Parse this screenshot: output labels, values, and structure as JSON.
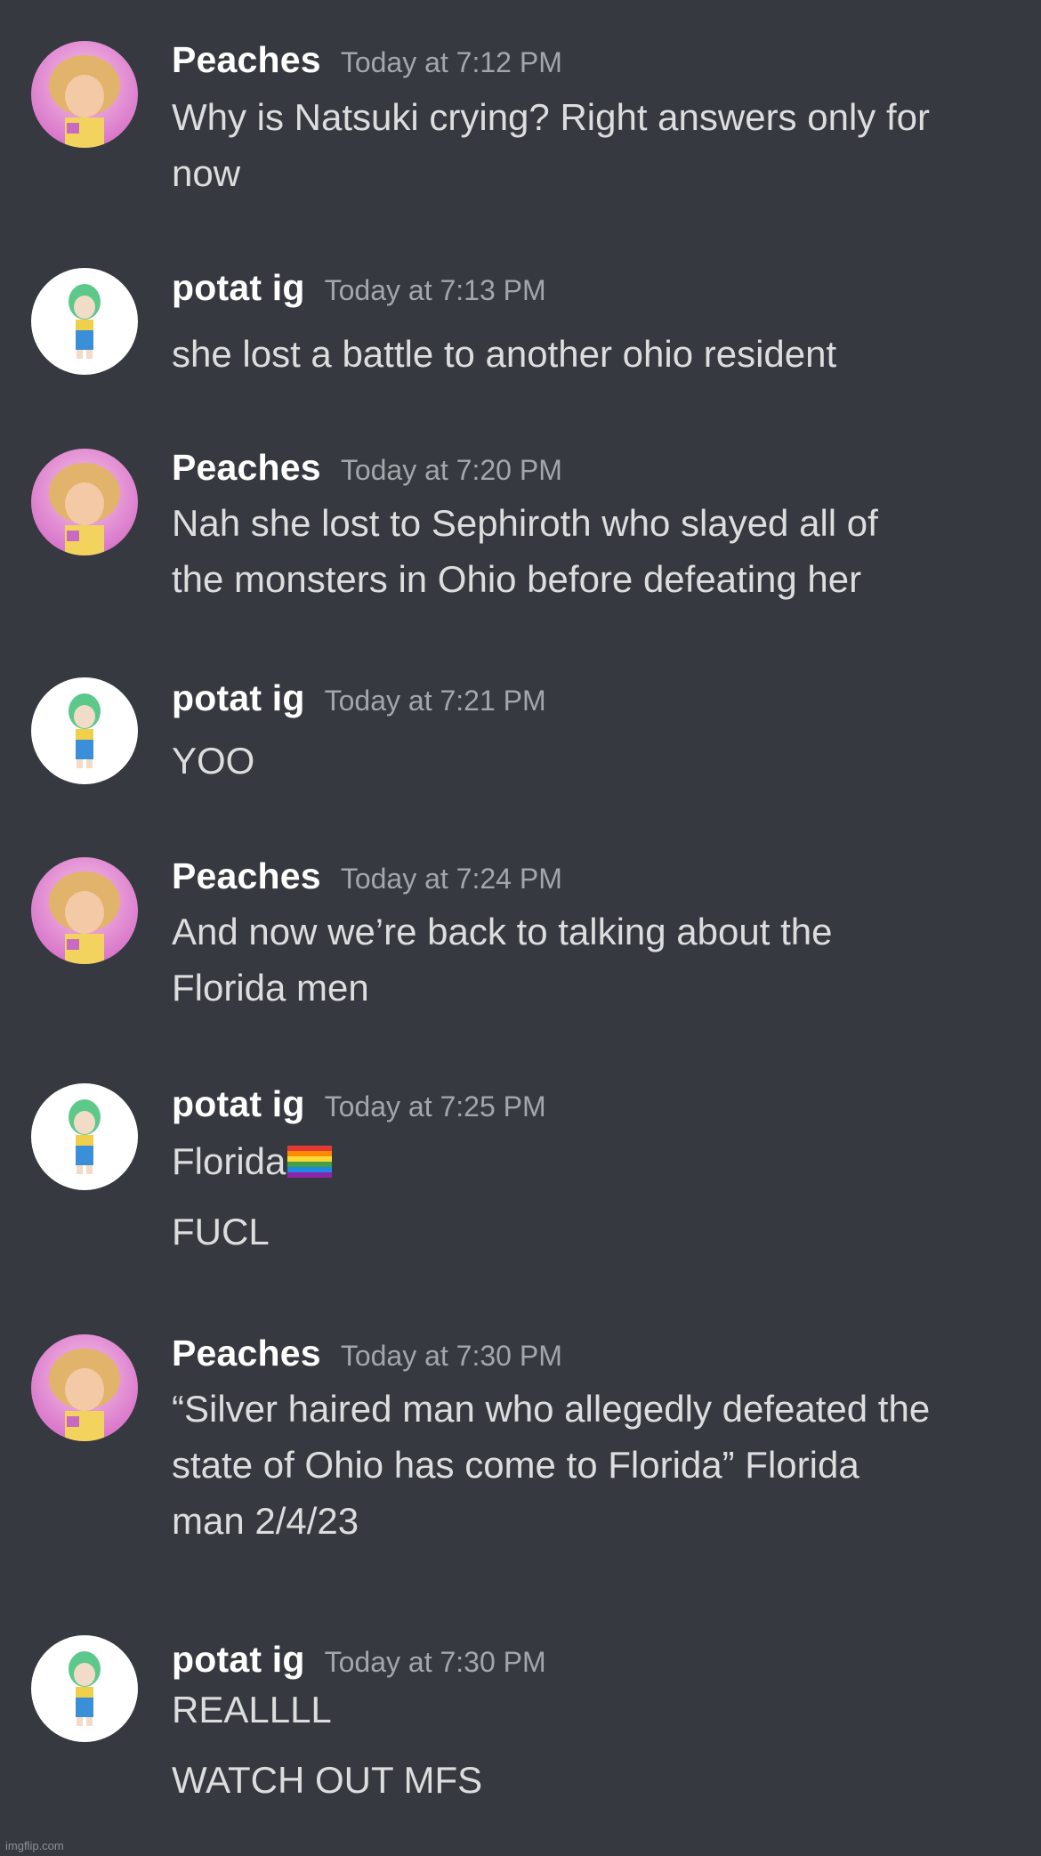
{
  "messages": [
    {
      "user": "Peaches",
      "time": "Today at 7:12 PM",
      "lines": [
        "Why is Natsuki crying? Right answers only for",
        "now"
      ]
    },
    {
      "user": "potat ig",
      "time": "Today at 7:13 PM",
      "lines": [
        "she lost a battle to another ohio resident"
      ]
    },
    {
      "user": "Peaches",
      "time": "Today at 7:20 PM",
      "lines": [
        "Nah she lost to Sephiroth who slayed all of",
        "the monsters in Ohio before defeating her"
      ]
    },
    {
      "user": "potat ig",
      "time": "Today at 7:21 PM",
      "lines": [
        "YOO"
      ]
    },
    {
      "user": "Peaches",
      "time": "Today at 7:24 PM",
      "lines": [
        "And now we’re back to talking about the",
        "Florida men"
      ]
    },
    {
      "user": "potat ig",
      "time": "Today at 7:25 PM",
      "lines": [
        "Florida",
        "FUCL"
      ],
      "emoji": "rainbow-flag-icon"
    },
    {
      "user": "Peaches",
      "time": "Today at 7:30 PM",
      "lines": [
        "“Silver haired man who allegedly defeated the",
        "state of Ohio has come to Florida” Florida",
        "man 2/4/23"
      ]
    },
    {
      "user": "potat ig",
      "time": "Today at 7:30 PM",
      "lines": [
        "REALLLL",
        "WATCH OUT MFS"
      ]
    }
  ],
  "watermark": "imgflip.com",
  "colors": {
    "background": "#36393f",
    "username": "#ffffff",
    "timestamp": "#a3a6aa",
    "message_text": "#dcddde"
  }
}
